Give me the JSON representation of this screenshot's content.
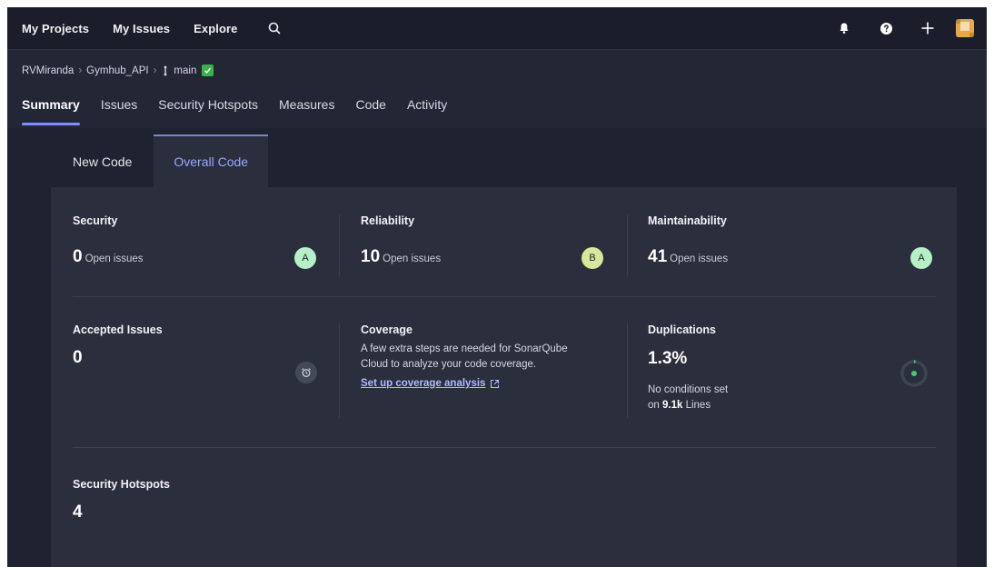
{
  "topnav": {
    "items": [
      "My Projects",
      "My Issues",
      "Explore"
    ],
    "icons": [
      "search-icon",
      "bell-icon",
      "help-icon",
      "plus-icon",
      "avatar"
    ]
  },
  "breadcrumb": {
    "org": "RVMiranda",
    "project": "Gymhub_API",
    "branch": "main"
  },
  "tabs": [
    "Summary",
    "Issues",
    "Security Hotspots",
    "Measures",
    "Code",
    "Activity"
  ],
  "code_tabs": [
    "New Code",
    "Overall Code"
  ],
  "security": {
    "title": "Security",
    "count": "0",
    "label": "Open issues",
    "rating": "A"
  },
  "reliability": {
    "title": "Reliability",
    "count": "10",
    "label": "Open issues",
    "rating": "B"
  },
  "maintainability": {
    "title": "Maintainability",
    "count": "41",
    "label": "Open issues",
    "rating": "A"
  },
  "accepted": {
    "title": "Accepted Issues",
    "count": "0"
  },
  "coverage": {
    "title": "Coverage",
    "desc_line1": "A few extra steps are needed for SonarQube",
    "desc_line2": "Cloud to analyze your code coverage.",
    "link": "Set up coverage analysis"
  },
  "duplications": {
    "title": "Duplications",
    "value": "1.3%",
    "note_line1": "No conditions set",
    "note_prefix": "on ",
    "lines": "9.1k",
    "lines_label": " Lines"
  },
  "hotspots": {
    "title": "Security Hotspots",
    "count": "4"
  },
  "colors": {
    "rating_a": "#b6f0c7",
    "rating_b": "#d6e99b",
    "accent": "#7f8fff",
    "link": "#aebcff",
    "branch_ok": "#38b249"
  }
}
